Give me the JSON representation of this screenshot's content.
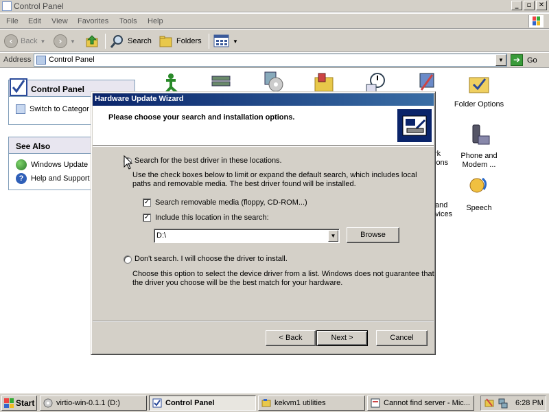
{
  "control_panel": {
    "title": "Control Panel",
    "window_buttons": {
      "minimize": "_",
      "maximize": "▫",
      "close": "✕"
    },
    "menu": [
      "File",
      "Edit",
      "View",
      "Favorites",
      "Tools",
      "Help"
    ],
    "toolbar": {
      "back": "Back",
      "search": "Search",
      "folders": "Folders"
    },
    "address": {
      "label": "Address",
      "value": "Control Panel",
      "go": "Go"
    },
    "task_pane": {
      "panel_title": "Control Panel",
      "switch_label": "Switch to Categor",
      "see_also_title": "See Also",
      "see_also_items": [
        "Windows Update",
        "Help and Support"
      ]
    },
    "items": {
      "folder_options": "Folder Options",
      "phone_modem_1": "Phone and",
      "phone_modem_2": "Modem ...",
      "speech": "Speech",
      "partial_1a": "y",
      "partial_2a": "rk",
      "partial_2b": "ions",
      "partial_3a": "and",
      "partial_3b": "vices"
    }
  },
  "wizard": {
    "title": "Hardware Update Wizard",
    "header": "Please choose your search and installation options.",
    "option_search": {
      "label": "Search for the best driver in these locations.",
      "desc_1": "Use the check boxes below to limit or expand the default search, which includes local",
      "desc_2": "paths and removable media. The best driver found will be installed.",
      "check_removable": "Search removable media (floppy, CD-ROM...)",
      "check_include": "Include this location in the search:",
      "location_value": "D:\\",
      "browse": "Browse"
    },
    "option_manual": {
      "label": "Don't search. I will choose the driver to install.",
      "desc_1": "Choose this option to select the device driver from a list.  Windows does not guarantee that",
      "desc_2": "the driver you choose will be the best match for your hardware."
    },
    "buttons": {
      "back": "< Back",
      "next": "Next >",
      "cancel": "Cancel"
    }
  },
  "taskbar": {
    "start": "Start",
    "tasks": [
      "virtio-win-0.1.1 (D:)",
      "Control Panel",
      "kekvm1 utilities",
      "Cannot find server - Mic..."
    ],
    "clock": "6:28 PM"
  }
}
